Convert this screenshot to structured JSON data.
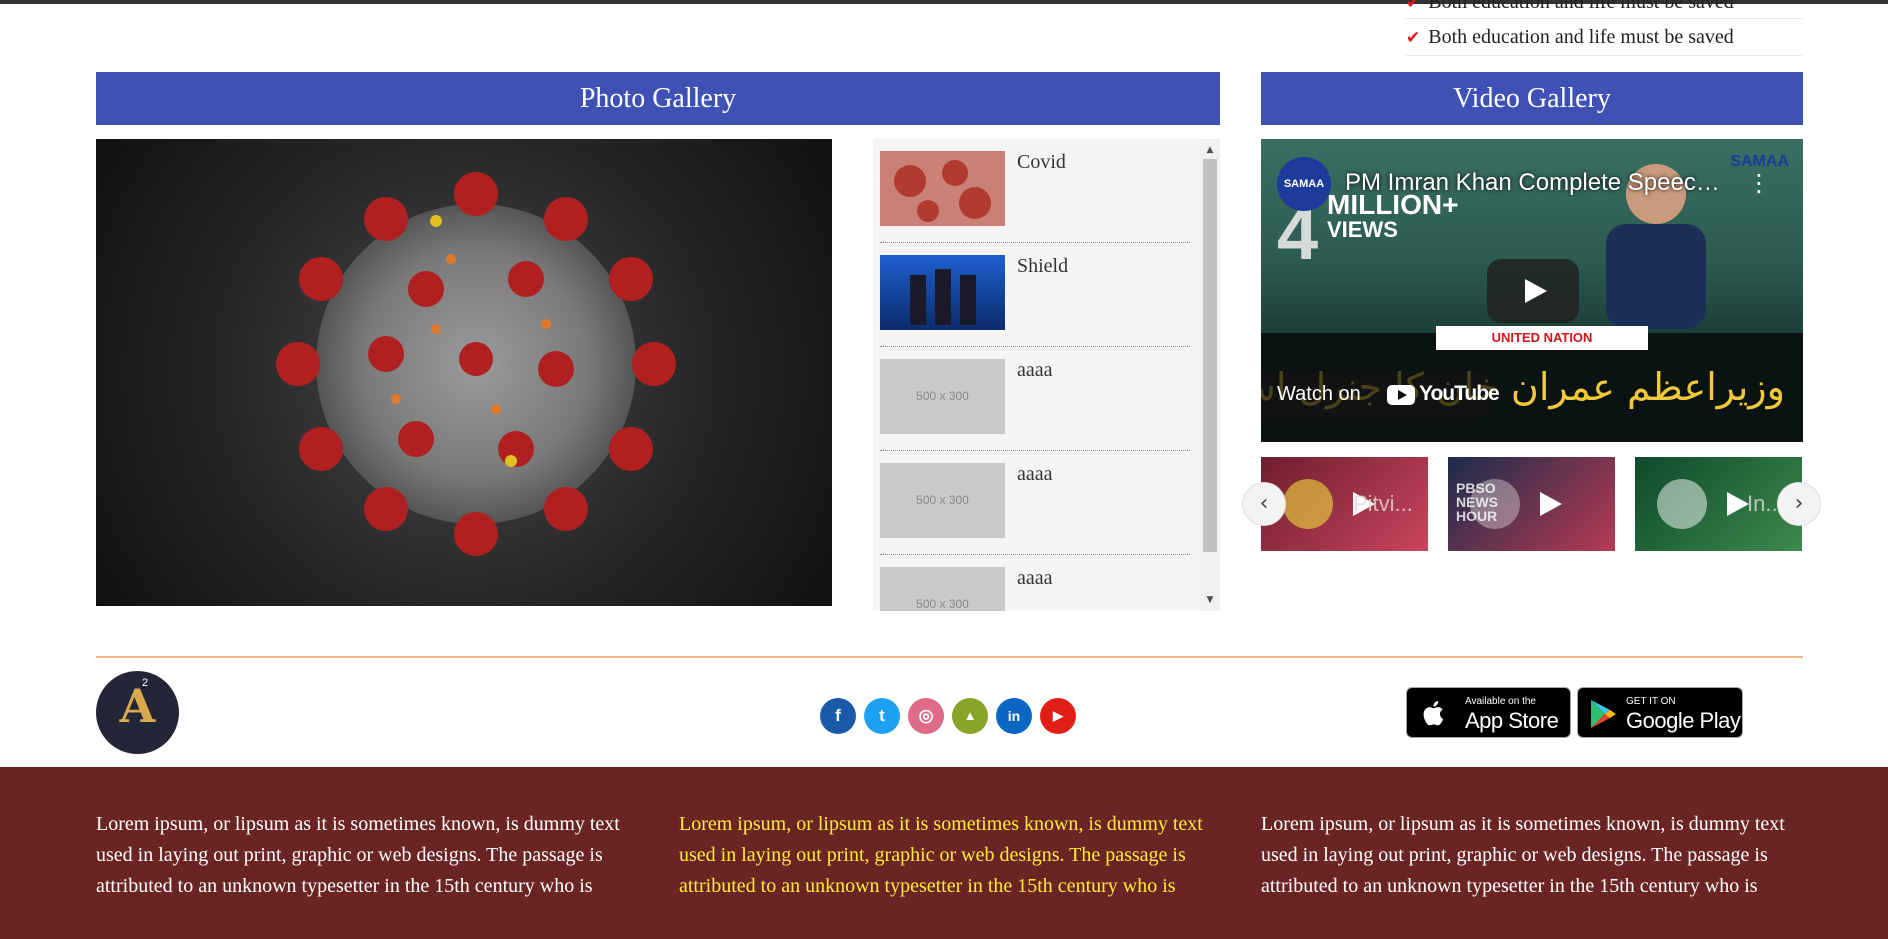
{
  "checklist": {
    "items": [
      "Both education and life must be saved",
      "Both education and life must be saved"
    ]
  },
  "photo_gallery": {
    "heading": "Photo Gallery",
    "items": [
      {
        "title": "Covid",
        "thumb": "covid-image"
      },
      {
        "title": "Shield",
        "thumb": "wrestlers-image"
      },
      {
        "title": "aaaa",
        "thumb": "placeholder",
        "placeholder": "500 x 300"
      },
      {
        "title": "aaaa",
        "thumb": "placeholder",
        "placeholder": "500 x 300"
      },
      {
        "title": "aaaa",
        "thumb": "placeholder",
        "placeholder": "500 x 300"
      }
    ]
  },
  "video_gallery": {
    "heading": "Video Gallery",
    "player": {
      "channel_badge": "SAMAA",
      "title": "PM Imran Khan Complete Speech ...",
      "views_number": "4",
      "views_million": "MILLION+",
      "views_label": "VIEWS",
      "logo": "SAMAA",
      "banner": "UNITED NATION",
      "urdu_caption": "وزیراعظم عمران خان کا جنرل اسمبلی",
      "watch_on": "Watch on",
      "youtube": "YouTube"
    },
    "thumbs": [
      {
        "label": "Pitvi..."
      },
      {
        "label": "PBSO NEWS HOUR"
      },
      {
        "label": "In..."
      }
    ]
  },
  "social": [
    {
      "name": "facebook",
      "glyph": "f",
      "color": "#1a5aa9"
    },
    {
      "name": "twitter",
      "glyph": "t",
      "color": "#1da1f2"
    },
    {
      "name": "instagram",
      "glyph": "◎",
      "color": "#e06b86"
    },
    {
      "name": "android",
      "glyph": "▲",
      "color": "#87a629"
    },
    {
      "name": "linkedin",
      "glyph": "in",
      "color": "#0a66c2"
    },
    {
      "name": "youtube",
      "glyph": "▶",
      "color": "#e01e14"
    }
  ],
  "stores": {
    "app_store_small": "Available on the",
    "app_store_big": "App Store",
    "google_play_small": "GET IT ON",
    "google_play_big": "Google Play"
  },
  "logo": {
    "letter": "A",
    "sup": "2"
  },
  "footer": {
    "col1": "Lorem ipsum, or lipsum as it is sometimes known, is dummy text used in laying out print, graphic or web designs. The passage is attributed to an unknown typesetter in the 15th century who is",
    "col2": "Lorem ipsum, or lipsum as it is sometimes known, is dummy text used in laying out print, graphic or web designs. The passage is attributed to an unknown typesetter in the 15th century who is",
    "col3": "Lorem ipsum, or lipsum as it is sometimes known, is dummy text used in laying out print, graphic or web designs. The passage is attributed to an unknown typesetter in the 15th century who is"
  },
  "colors": {
    "header_bar": "#3f51b5",
    "footer_bg": "#6b2424",
    "footer_highlight": "#ffeb3b",
    "check": "#e0151c",
    "divider": "#f2b38f"
  }
}
